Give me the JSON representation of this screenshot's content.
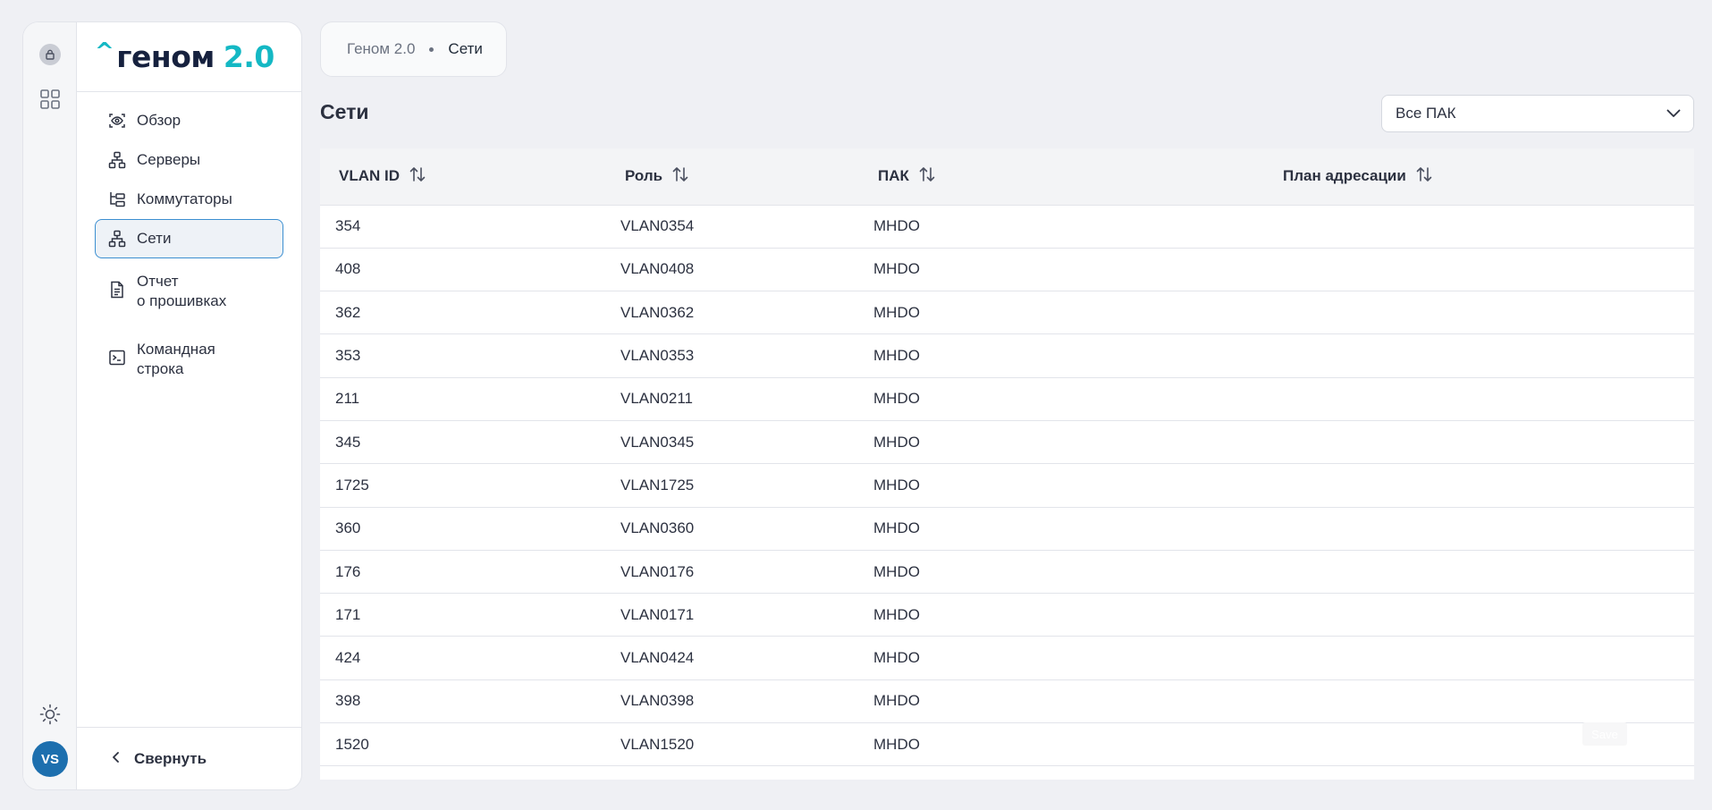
{
  "app": {
    "logo_caret": "^",
    "logo_word": "геном",
    "logo_version": "2.0"
  },
  "rail": {
    "avatar_initials": "VS"
  },
  "nav": {
    "items": [
      {
        "label": "Обзор",
        "icon": "eye-scan-icon",
        "active": false
      },
      {
        "label": "Серверы",
        "icon": "network-tree-icon",
        "active": false
      },
      {
        "label": "Коммутаторы",
        "icon": "switch-hierarchy-icon",
        "active": false
      },
      {
        "label": "Сети",
        "icon": "network-tree-icon",
        "active": true
      },
      {
        "label": "Отчет\nо прошивках",
        "icon": "document-icon",
        "active": false
      },
      {
        "label": "Командная\nстрока",
        "icon": "terminal-icon",
        "active": false
      }
    ],
    "collapse_label": "Свернуть"
  },
  "breadcrumb": {
    "items": [
      "Геном 2.0",
      "Сети"
    ]
  },
  "page": {
    "title": "Сети"
  },
  "filter": {
    "selected": "Все ПАК"
  },
  "table": {
    "columns": [
      "VLAN ID",
      "Роль",
      "ПАК",
      "План адресации"
    ],
    "rows": [
      [
        "354",
        "VLAN0354",
        "MHDO",
        ""
      ],
      [
        "408",
        "VLAN0408",
        "MHDO",
        ""
      ],
      [
        "362",
        "VLAN0362",
        "MHDO",
        ""
      ],
      [
        "353",
        "VLAN0353",
        "MHDO",
        ""
      ],
      [
        "211",
        "VLAN0211",
        "MHDO",
        ""
      ],
      [
        "345",
        "VLAN0345",
        "MHDO",
        ""
      ],
      [
        "1725",
        "VLAN1725",
        "MHDO",
        ""
      ],
      [
        "360",
        "VLAN0360",
        "MHDO",
        ""
      ],
      [
        "176",
        "VLAN0176",
        "MHDO",
        ""
      ],
      [
        "171",
        "VLAN0171",
        "MHDO",
        ""
      ],
      [
        "424",
        "VLAN0424",
        "MHDO",
        ""
      ],
      [
        "398",
        "VLAN0398",
        "MHDO",
        ""
      ],
      [
        "1520",
        "VLAN1520",
        "MHDO",
        ""
      ]
    ]
  },
  "ghost_button": {
    "label": "Save"
  },
  "colors": {
    "accent": "#14b8c4",
    "active_border": "#3b8fd1",
    "avatar": "#1d6fae"
  }
}
